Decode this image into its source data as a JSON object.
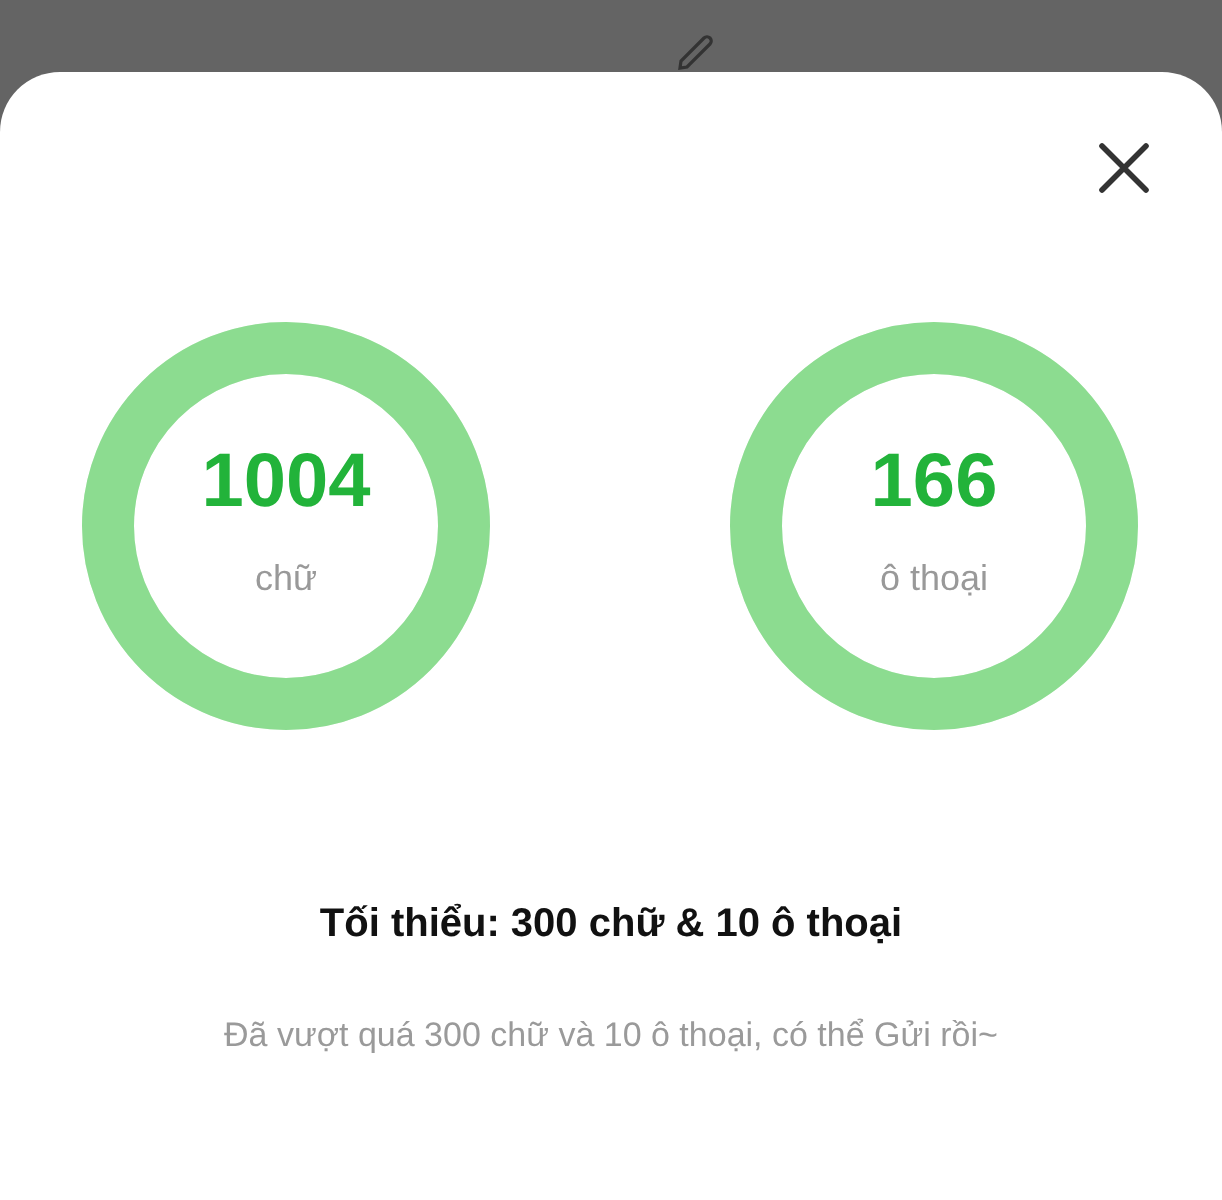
{
  "counters": [
    {
      "value": "1004",
      "label": "chữ",
      "level": 1
    },
    {
      "value": "166",
      "label": "ô thoại",
      "level": 1
    }
  ],
  "requirement": "Tối thiểu: 300 chữ & 10 ô thoại",
  "status_message": "Đã vượt quá 300 chữ và 10 ô thoại, có thể Gửi rồi~"
}
